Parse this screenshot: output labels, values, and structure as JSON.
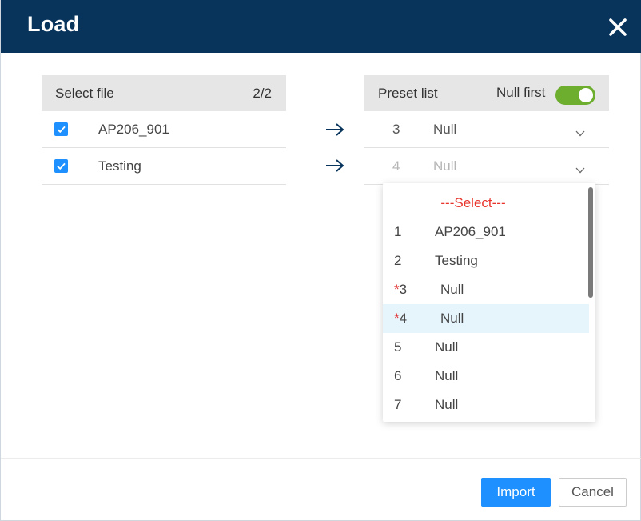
{
  "dialog": {
    "title": "Load",
    "close_icon": "close-icon"
  },
  "left_panel": {
    "header_label": "Select file",
    "header_count": "2/2",
    "files": [
      {
        "name": "AP206_901",
        "checked": true
      },
      {
        "name": "Testing",
        "checked": true
      }
    ]
  },
  "right_panel": {
    "header_label": "Preset list",
    "null_first_label": "Null first",
    "null_first_on": true,
    "rows": [
      {
        "num": "3",
        "value": "Null"
      },
      {
        "num": "4",
        "value": "Null"
      }
    ]
  },
  "dropdown": {
    "placeholder": "---Select---",
    "items": [
      {
        "num": "1",
        "star": "",
        "value": "AP206_901"
      },
      {
        "num": "2",
        "star": "",
        "value": "Testing"
      },
      {
        "num": "3",
        "star": "*",
        "value": "Null"
      },
      {
        "num": "4",
        "star": "*",
        "value": "Null",
        "selected": true
      },
      {
        "num": "5",
        "star": "",
        "value": "Null"
      },
      {
        "num": "6",
        "star": "",
        "value": "Null"
      },
      {
        "num": "7",
        "star": "",
        "value": "Null"
      }
    ]
  },
  "footer": {
    "import_label": "Import",
    "cancel_label": "Cancel"
  },
  "colors": {
    "header_bg": "#08345c",
    "accent": "#1e90ff",
    "toggle_on": "#6dae2f",
    "required_mark": "#e03030",
    "select_placeholder": "#e8352c",
    "selected_row_bg": "#e6f4fc"
  }
}
